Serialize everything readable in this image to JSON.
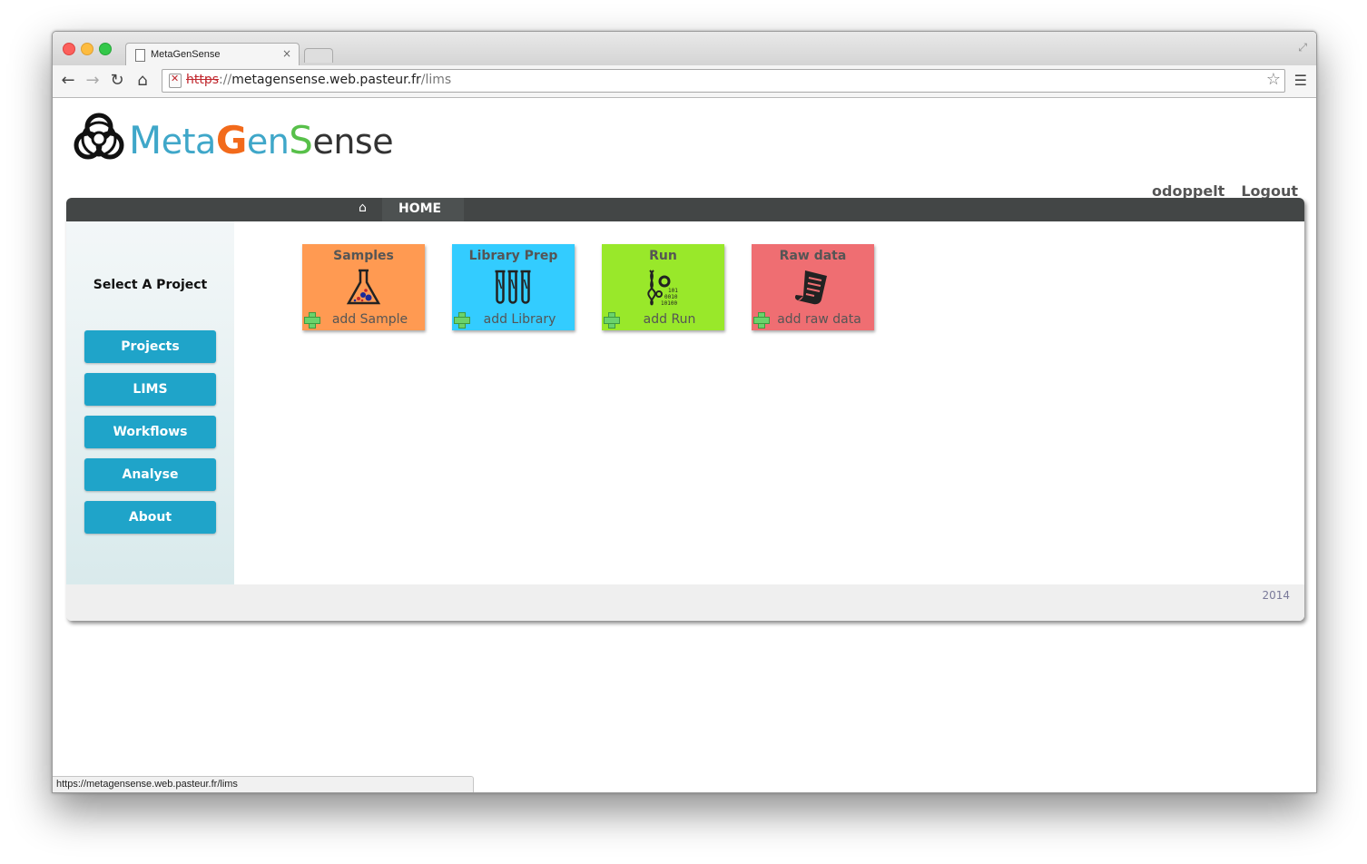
{
  "browser": {
    "tab_title": "MetaGenSense",
    "tab_close": "×",
    "url_scheme": "https",
    "url_sep": "://",
    "url_host": "metagensense.web.pasteur.fr",
    "url_path": "/lims",
    "status_url": "https://metagensense.web.pasteur.fr/lims"
  },
  "logo": {
    "m": "M",
    "c1": "eta",
    "g": "G",
    "c2": "en",
    "s": "S",
    "c3": "ense"
  },
  "user": {
    "name": "odoppelt",
    "logout": "Logout"
  },
  "nav": {
    "home": "HOME"
  },
  "sidebar": {
    "heading": "Select A Project",
    "items": [
      {
        "label": "Projects"
      },
      {
        "label": "LIMS"
      },
      {
        "label": "Workflows"
      },
      {
        "label": "Analyse"
      },
      {
        "label": "About"
      }
    ]
  },
  "cards": [
    {
      "title": "Samples",
      "add": "add Sample",
      "color": "#ff9a52"
    },
    {
      "title": "Library Prep",
      "add": "add Library",
      "color": "#33ccff"
    },
    {
      "title": "Run",
      "add": "add Run",
      "color": "#99e82a"
    },
    {
      "title": "Raw data",
      "add": "add raw data",
      "color": "#ef6e72"
    }
  ],
  "footer": {
    "year": "2014"
  },
  "colors": {
    "accent": "#1fa4c9",
    "navbar": "#434646"
  }
}
